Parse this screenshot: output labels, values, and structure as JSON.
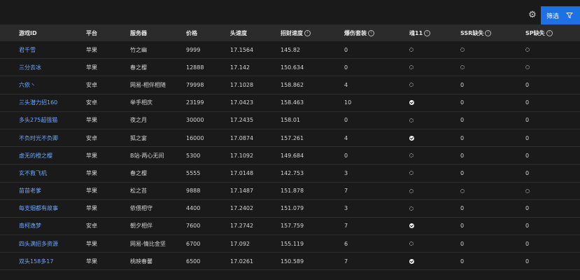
{
  "toolbar": {
    "settings_icon": "gear-icon",
    "filter_label": "筛选",
    "filter_icon": "funnel-icon",
    "accent": "#1f6fe5"
  },
  "table": {
    "columns": [
      "游戏ID",
      "平台",
      "服务器",
      "价格",
      "头速度",
      "招财速度",
      "爆伤套装",
      "魂11",
      "SSR缺失",
      "SP缺失"
    ],
    "info_columns": [
      5,
      6,
      7,
      8,
      9
    ],
    "rows": [
      [
        "君千雪",
        "苹果",
        "竹之幽",
        "9999",
        "17.1564",
        "145.82",
        "0",
        "empty",
        "empty",
        "empty"
      ],
      [
        "三分去冰",
        "苹果",
        "春之樱",
        "12888",
        "17.142",
        "150.634",
        "0",
        "empty",
        "empty",
        "empty"
      ],
      [
        "六依丶",
        "安卓",
        "网易-相伴相随",
        "79998",
        "17.1028",
        "158.862",
        "4",
        "empty",
        "0",
        "0"
      ],
      [
        "三头潜力招160",
        "安卓",
        "举手相庆",
        "23199",
        "17.0423",
        "158.463",
        "10",
        "check",
        "0",
        "0"
      ],
      [
        "多头275超强猫",
        "苹果",
        "夜之月",
        "30000",
        "17.2435",
        "158.01",
        "0",
        "empty",
        "0",
        "0"
      ],
      [
        "不负时光不负卿",
        "安卓",
        "狐之宴",
        "16000",
        "17.0874",
        "157.261",
        "4",
        "check",
        "0",
        "0"
      ],
      [
        "虚无的橙之樱",
        "苹果",
        "B站-两心无间",
        "5300",
        "17.1092",
        "149.684",
        "0",
        "empty",
        "0",
        "0"
      ],
      [
        "玄不救飞机",
        "苹果",
        "春之樱",
        "5555",
        "17.0148",
        "142.753",
        "3",
        "empty",
        "0",
        "0"
      ],
      [
        "苗苗老爹",
        "苹果",
        "松之苔",
        "9888",
        "17.1487",
        "151.878",
        "7",
        "empty",
        "empty",
        "empty"
      ],
      [
        "每支烟都有故事",
        "苹果",
        "依偎相守",
        "4400",
        "17.2402",
        "151.079",
        "3",
        "empty",
        "0",
        "0"
      ],
      [
        "南柯逸梦",
        "安卓",
        "朝夕相伴",
        "7600",
        "17.2742",
        "157.759",
        "7",
        "check",
        "0",
        "0"
      ],
      [
        "四头满招多资源",
        "苹果",
        "网易-情比金坚",
        "6700",
        "17.092",
        "155.119",
        "6",
        "empty",
        "0",
        "0"
      ],
      [
        "双头158多17",
        "苹果",
        "桃映春馨",
        "6500",
        "17.0261",
        "150.589",
        "7",
        "check",
        "0",
        "0"
      ]
    ]
  }
}
